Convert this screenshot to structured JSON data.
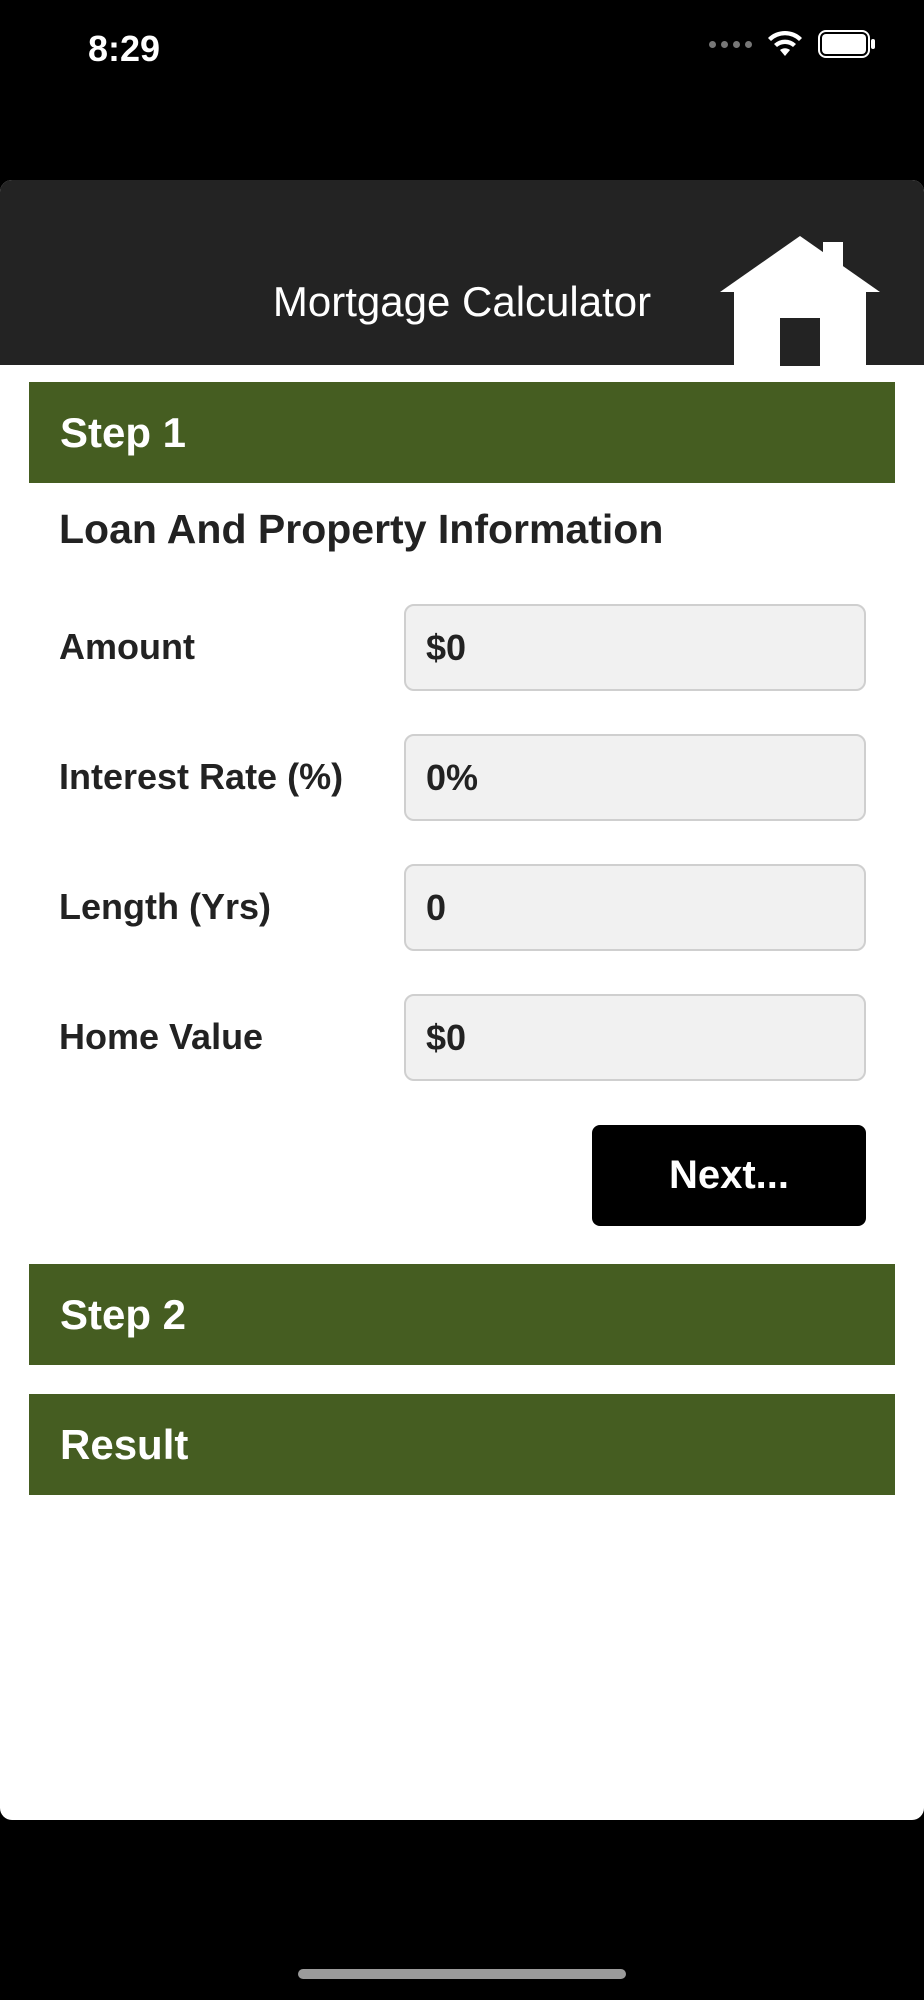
{
  "status_bar": {
    "time": "8:29"
  },
  "header": {
    "title": "Mortgage Calculator"
  },
  "step1": {
    "bar_label": "Step 1",
    "heading": "Loan And Property Information",
    "fields": [
      {
        "label": "Amount",
        "value": "$0"
      },
      {
        "label": "Interest Rate (%)",
        "value": "0%"
      },
      {
        "label": "Length (Yrs)",
        "value": "0"
      },
      {
        "label": "Home Value",
        "value": "$0"
      }
    ],
    "next_label": "Next..."
  },
  "step2": {
    "bar_label": "Step 2"
  },
  "result": {
    "bar_label": "Result"
  },
  "colors": {
    "section_bar": "#455d21",
    "header_bg": "#232323"
  }
}
